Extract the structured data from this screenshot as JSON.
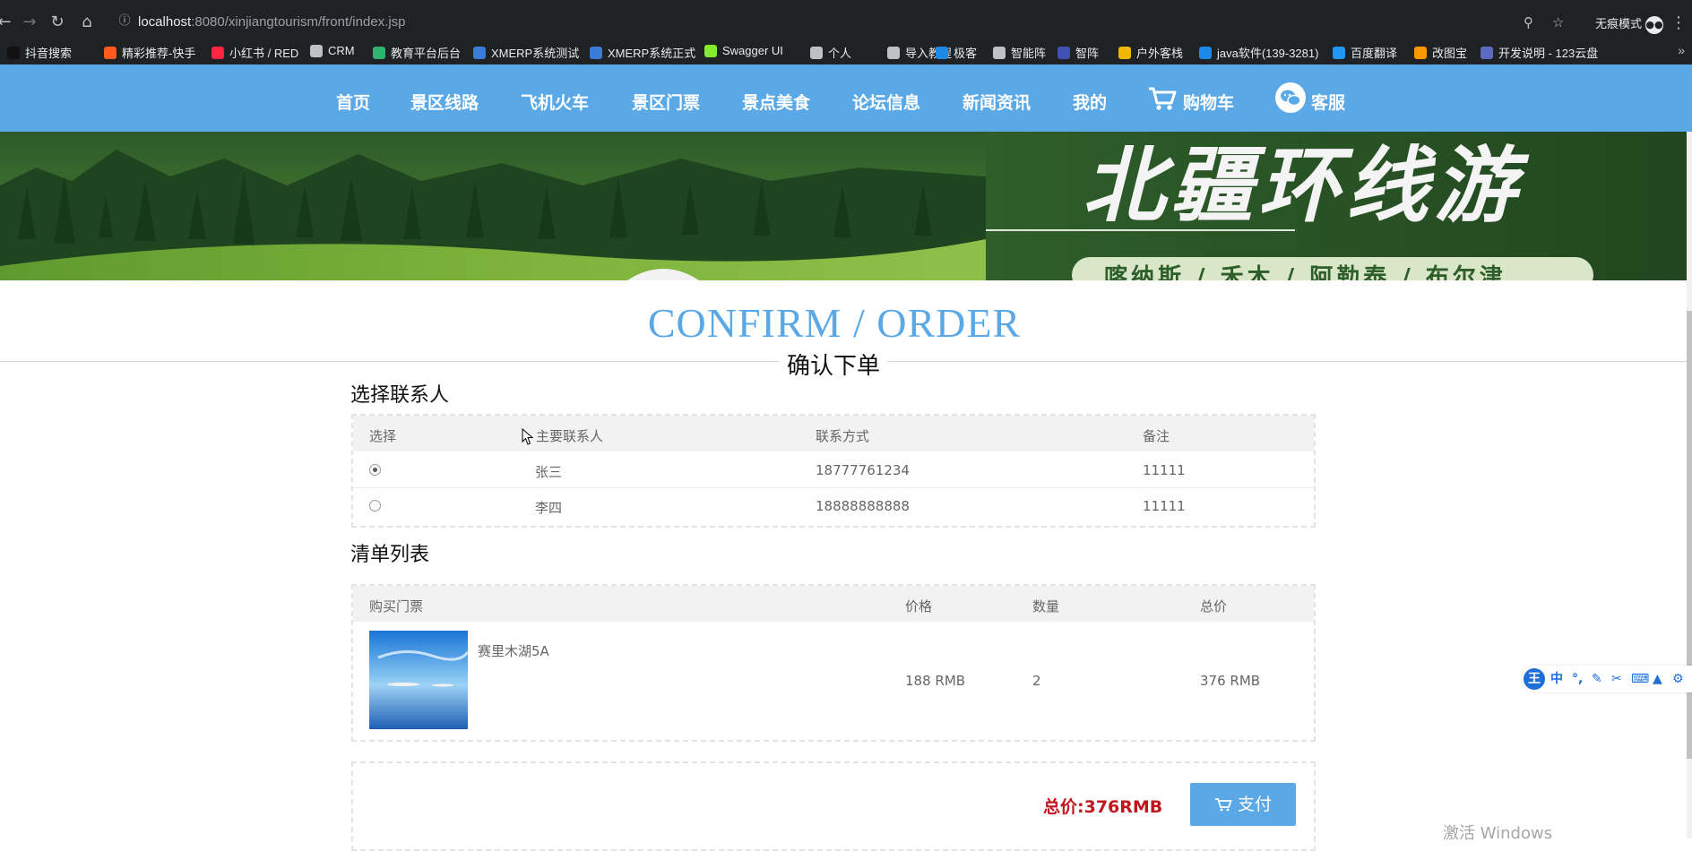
{
  "browser": {
    "url_host": "localhost",
    "url_rest": ":8080/xinjiangtourism/front/index.jsp",
    "incognito_label": "无痕模式",
    "bookmarks": [
      {
        "label": "抖音搜索",
        "color": "#111111"
      },
      {
        "label": "精彩推荐-快手",
        "color": "#ff5a1f"
      },
      {
        "label": "小红书 / RED",
        "color": "#ff2442"
      },
      {
        "label": "CRM",
        "color": "#bdc1c6"
      },
      {
        "label": "教育平台后台",
        "color": "#2fb36d"
      },
      {
        "label": "XMERP系统测试",
        "color": "#3a7bd5"
      },
      {
        "label": "XMERP系统正式",
        "color": "#3a7bd5"
      },
      {
        "label": "Swagger UI",
        "color": "#85ea2d"
      },
      {
        "label": "个人",
        "color": "#bdc1c6"
      },
      {
        "label": "导入教程",
        "color": "#bdc1c6"
      },
      {
        "label": "极客",
        "color": "#1e88e5"
      },
      {
        "label": "智能阵",
        "color": "#bdc1c6"
      },
      {
        "label": "智阵",
        "color": "#3f51b5"
      },
      {
        "label": "户外客栈",
        "color": "#f2b705"
      },
      {
        "label": "java软件(139-3281)",
        "color": "#1e88e5"
      },
      {
        "label": "百度翻译",
        "color": "#2196f3"
      },
      {
        "label": "改图宝",
        "color": "#ff9800"
      },
      {
        "label": "开发说明 - 123云盘",
        "color": "#5c6bc0"
      }
    ]
  },
  "nav": {
    "items": [
      "首页",
      "景区线路",
      "飞机火车",
      "景区门票",
      "景点美食",
      "论坛信息",
      "新闻资讯",
      "我的"
    ],
    "cart": "购物车",
    "service": "客服"
  },
  "banner": {
    "title": "北疆环线游",
    "subtitle": "喀纳斯 / 禾木 / 阿勒泰 / 布尔津"
  },
  "heading": {
    "en": "CONFIRM / ORDER",
    "cn": "确认下单"
  },
  "contacts": {
    "title": "选择联系人",
    "headers": [
      "选择",
      "主要联系人",
      "联系方式",
      "备注"
    ],
    "rows": [
      {
        "selected": true,
        "name": "张三",
        "phone": "18777761234",
        "note": "11111"
      },
      {
        "selected": false,
        "name": "李四",
        "phone": "18888888888",
        "note": "11111"
      }
    ]
  },
  "cart": {
    "title": "清单列表",
    "headers": [
      "购买门票",
      "价格",
      "数量",
      "总价"
    ],
    "items": [
      {
        "name": "赛里木湖5A",
        "price": "188 RMB",
        "qty": "2",
        "total": "376 RMB"
      }
    ]
  },
  "payment": {
    "total_label": "总价:376RMB",
    "pay_label": "支付"
  },
  "overlay": {
    "watermark": "激活 Windows",
    "ime_logo": "王",
    "ime_mode": "中"
  },
  "colors": {
    "accent": "#5aa9e6",
    "total_red": "#c0161d"
  }
}
